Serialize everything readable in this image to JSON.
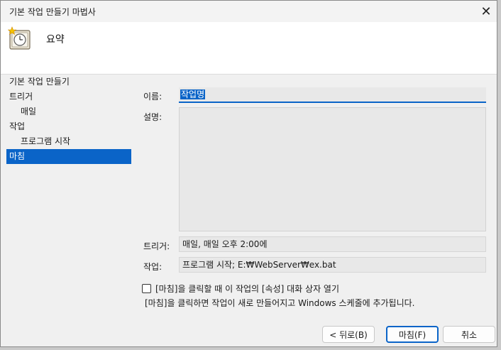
{
  "window": {
    "title": "기본 작업 만들기 마법사",
    "close_glyph": "✕"
  },
  "header": {
    "heading": "요약",
    "icon": "clock-sparkle-icon"
  },
  "sidebar": {
    "items": [
      {
        "label": "기본 작업 만들기"
      },
      {
        "label": "트리거"
      },
      {
        "label": "매일"
      },
      {
        "label": "작업"
      },
      {
        "label": "프로그램 시작"
      },
      {
        "label": "마침"
      }
    ]
  },
  "form": {
    "name_label": "이름:",
    "name_value": "작업명",
    "description_label": "설명:",
    "description_value": "",
    "trigger_label": "트리거:",
    "trigger_value": "매일, 매일 오후 2:00에",
    "action_label": "작업:",
    "action_value": "프로그램 시작; E:₩WebServer₩ex.bat"
  },
  "checkbox": {
    "label": "[마침]을 클릭할 때 이 작업의 [속성] 대화 상자 열기",
    "checked": false
  },
  "info": "[마침]을 클릭하면 작업이 새로 만들어지고 Windows 스케줄에 추가됩니다.",
  "buttons": {
    "back": "< 뒤로(B)",
    "finish": "마침(F)",
    "cancel": "취소"
  },
  "colors": {
    "accent": "#0a64c8",
    "dialog_bg": "#f0f0f0",
    "header_bg": "#ffffff"
  }
}
